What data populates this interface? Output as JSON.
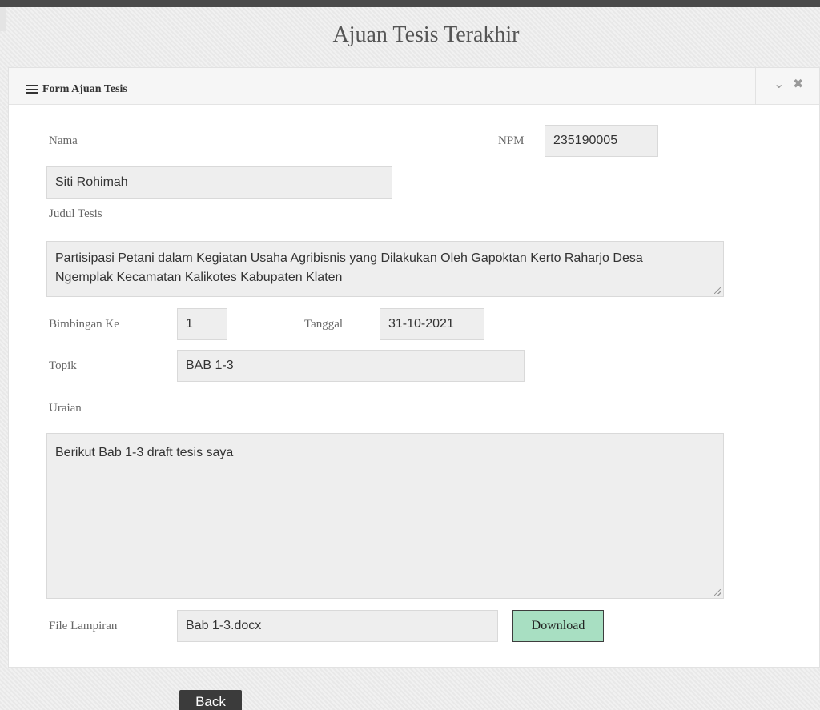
{
  "page": {
    "title": "Ajuan Tesis Terakhir"
  },
  "panel": {
    "title": "Form Ajuan Tesis",
    "icons": {
      "menu": "hamburger-icon",
      "collapse": "chevron-down-icon",
      "close": "close-icon"
    }
  },
  "form": {
    "nama": {
      "label": "Nama",
      "value": "Siti Rohimah"
    },
    "npm": {
      "label": "NPM",
      "value": "235190005"
    },
    "judul": {
      "label": "Judul Tesis",
      "value": "Partisipasi Petani dalam Kegiatan Usaha Agribisnis yang Dilakukan Oleh Gapoktan Kerto Raharjo Desa Ngemplak Kecamatan Kalikotes Kabupaten Klaten"
    },
    "bimbingan": {
      "label": "Bimbingan Ke",
      "value": "1"
    },
    "tanggal": {
      "label": "Tanggal",
      "value": "31-10-2021"
    },
    "topik": {
      "label": "Topik",
      "value": "BAB 1-3"
    },
    "uraian": {
      "label": "Uraian",
      "value": "Berikut Bab 1-3 draft tesis saya"
    },
    "lampiran": {
      "label": "File Lampiran",
      "value": "Bab 1-3.docx"
    },
    "download_label": "Download"
  },
  "actions": {
    "back_label": "Back"
  },
  "colors": {
    "download_bg": "#a8dfc2",
    "back_bg": "#3b3b3b",
    "field_bg": "#eeeeee"
  }
}
